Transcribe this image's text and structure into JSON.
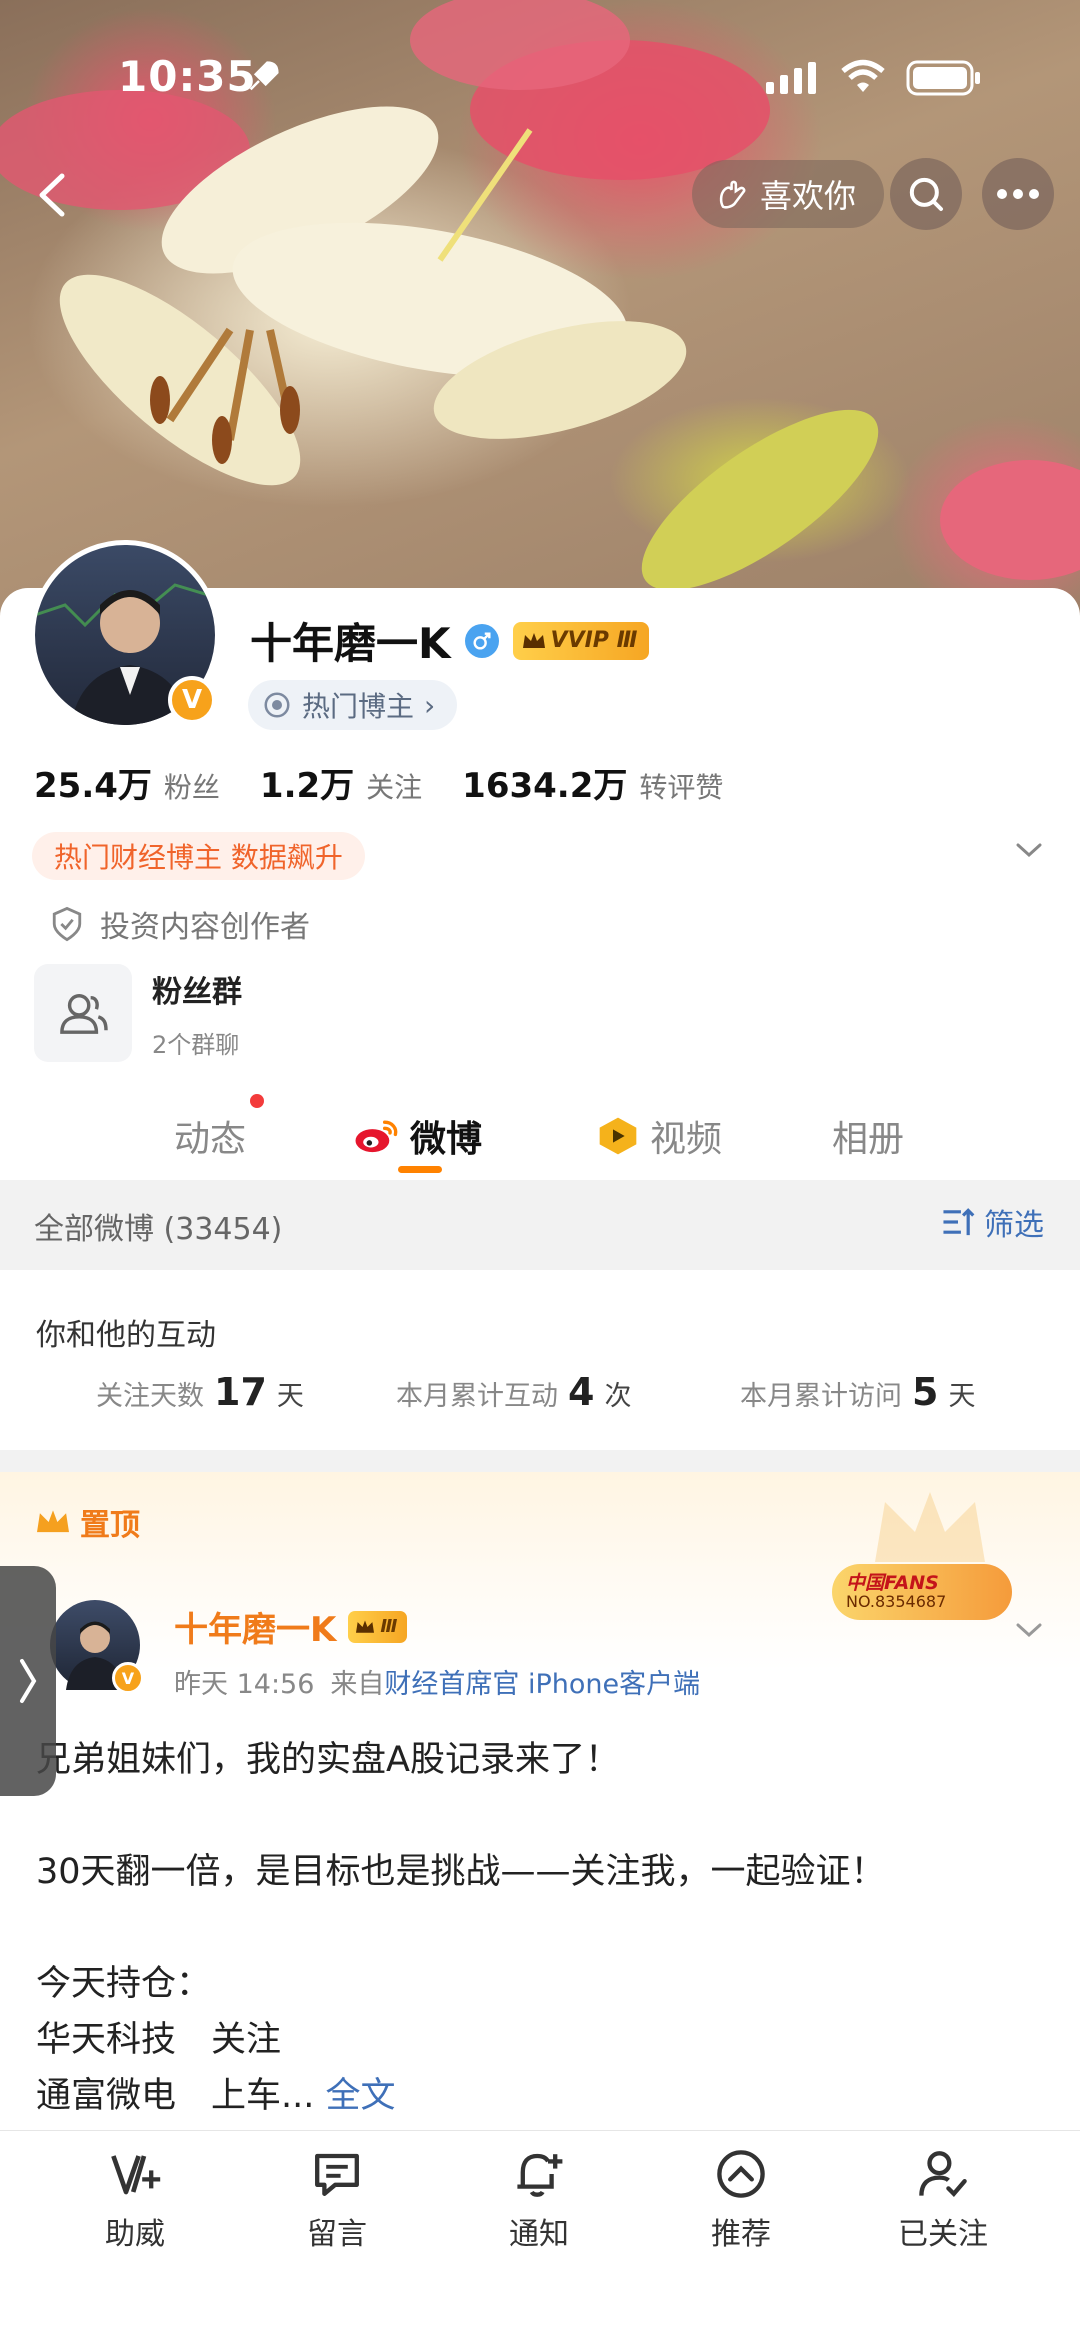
{
  "status_bar": {
    "time": "10:35"
  },
  "header": {
    "like_label": "喜欢你"
  },
  "profile": {
    "name": "十年磨一K",
    "vip_label": "VVIP Ⅲ",
    "verified_mark": "V",
    "hot_blogger_label": "热门博主",
    "stats": [
      {
        "num": "25.4万",
        "label": "粉丝"
      },
      {
        "num": "1.2万",
        "label": "关注"
      },
      {
        "num": "1634.2万",
        "label": "转评赞"
      }
    ],
    "hot_tag": "热门财经博主 数据飙升",
    "investor_label": "投资内容创作者",
    "fans_group": {
      "title": "粉丝群",
      "sub": "2个群聊"
    }
  },
  "tabs": [
    {
      "label": "动态"
    },
    {
      "label": "微博"
    },
    {
      "label": "视频"
    },
    {
      "label": "相册"
    }
  ],
  "filter": {
    "title": "全部微博 (33454)",
    "button": "筛选"
  },
  "interaction": {
    "title": "你和他的互动",
    "items": [
      {
        "label": "关注天数",
        "num": "17",
        "unit": "天"
      },
      {
        "label": "本月累计互动",
        "num": "4",
        "unit": "次"
      },
      {
        "label": "本月累计访问",
        "num": "5",
        "unit": "天"
      }
    ]
  },
  "post": {
    "pin_label": "置顶",
    "author": "十年磨一K",
    "vip_label": "Ⅲ",
    "medal_top": "中国FANS",
    "medal_bottom": "NO.8354687",
    "time": "昨天 14:56",
    "source_prefix": "来自",
    "source": "财经首席官 iPhone客户端",
    "lines": [
      "兄弟姐妹们，我的实盘A股记录来了！",
      "",
      "30天翻一倍，是目标也是挑战——关注我，一起验证！",
      "",
      "今天持仓：",
      "华天科技　关注"
    ],
    "last_line": "通富微电　上车...",
    "full_text": "全文"
  },
  "bottom_bar": [
    {
      "label": "助威",
      "icon": "cheer-icon"
    },
    {
      "label": "留言",
      "icon": "message-icon"
    },
    {
      "label": "通知",
      "icon": "bell-add-icon"
    },
    {
      "label": "推荐",
      "icon": "recommend-icon"
    },
    {
      "label": "已关注",
      "icon": "user-check-icon"
    }
  ],
  "colors": {
    "accent": "#ff8200",
    "link": "#3f70b8",
    "author": "#f07b1a",
    "vip": "#f6a623"
  }
}
